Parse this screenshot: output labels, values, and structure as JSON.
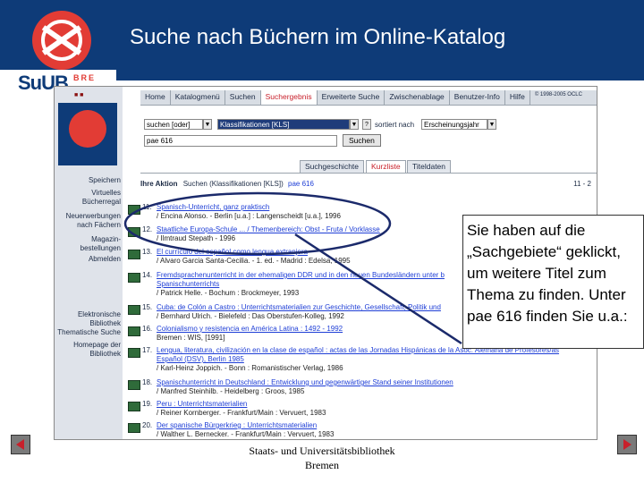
{
  "slide": {
    "title": "Suche nach Büchern im Online-Katalog",
    "logo": {
      "text": "SuUB",
      "sub": "BRE"
    },
    "footer_line1": "Staats- und Universitätsbibliothek",
    "footer_line2": "Bremen",
    "callout": "Sie haben auf die „Sachgebiete“ geklickt, um weitere Titel zum Thema zu finden. Unter pae 616  finden Sie u.a.:"
  },
  "opac": {
    "nav": {
      "home": "Home",
      "katalogmenue": "Katalogmenü",
      "suchen": "Suchen",
      "suchergebnis": "Suchergebnis",
      "erweiterte_suche": "Erweiterte Suche",
      "zwischenablage": "Zwischenablage",
      "benutzer_info": "Benutzer-Info",
      "hilfe": "Hilfe",
      "copyright": "© 1998-2005 OCLC"
    },
    "search": {
      "mode_value": "suchen [oder]",
      "field_value": "Klassifikationen [KLS]",
      "sort_label": "sortiert nach",
      "sort_value": "Erscheinungsjahr",
      "query_value": "pae 616",
      "submit_label": "Suchen"
    },
    "subtabs": {
      "suchgeschichte": "Suchgeschichte",
      "kurzliste": "Kurzliste",
      "titeldaten": "Titeldaten"
    },
    "action": {
      "label": "Ihre Aktion",
      "text": "Suchen (Klassifikationen [KLS])",
      "link": "pae 616",
      "page": "11 - 2"
    },
    "left_menu": {
      "speichern": "Speichern",
      "virtuelles_1": "Virtuelles",
      "virtuelles_2": "Bücherregal",
      "neuerwerb_1": "Neuerwerbungen",
      "neuerwerb_2": "nach Fächern",
      "magazin_1": "Magazin-",
      "magazin_2": "bestellungen",
      "abmelden": "Abmelden",
      "elek_1": "Elektronische",
      "elek_2": "Bibliothek",
      "themat": "Thematische Suche",
      "homepage_1": "Homepage der",
      "homepage_2": "Bibliothek"
    },
    "results": [
      {
        "num": "11.",
        "title": "Spanisch-Unterricht, ganz praktisch",
        "author": "/ Encina Alonso. - Berlin [u.a.] : Langenscheidt [u.a.], 1996"
      },
      {
        "num": "12.",
        "title": "Staatliche Europa-Schule ... / Themenbereich: Obst - Fruta / Vorklasse",
        "author": "/ Ilmtraud Stepath - 1996"
      },
      {
        "num": "13.",
        "title": "El currículo del español como lengua extranjera",
        "author": "/ Alvaro Garcia Santa-Cecilia. - 1. ed. - Madrid : Edelsa, 1995"
      },
      {
        "num": "14.",
        "title": "Fremdsprachenunterricht in der ehemaligen DDR und in den neuen Bundesländern unter b",
        "title2": "Spanischunterrichts",
        "author": "/ Patrick Helle. - Bochum : Brockmeyer, 1993"
      },
      {
        "num": "15.",
        "title": "Cuba: de Colón a Castro : Unterrichtsmaterialien zur Geschichte, Gesellschaft, Politik und",
        "author": "/ Bernhard Ulrich. - Bielefeld : Das Oberstufen-Kolleg, 1992"
      },
      {
        "num": "16.",
        "title": "Colonialismo y resistencia en América Latina : 1492 - 1992",
        "author": "Bremen : WIS, [1991]"
      },
      {
        "num": "17.",
        "title": "Lengua, literatura, civilización en la clase de español : actas de las Jornadas Hispánicas de la Asoc. Alemana de Profesores/as",
        "title2": "Español (DSV), Berlin 1985",
        "author": "/ Karl-Heinz Joppich. - Bonn : Romanistischer Verlag, 1986"
      },
      {
        "num": "18.",
        "title": "Spanischunterricht in Deutschland : Entwicklung und gegenwärtiger Stand seiner Institutionen",
        "author": "/ Manfred Steinhilb. - Heidelberg : Groos, 1985"
      },
      {
        "num": "19.",
        "title": "Peru : Unterrichtsmaterialien",
        "author": "/ Reiner Kornberger. - Frankfurt/Main : Vervuert, 1983"
      },
      {
        "num": "20.",
        "title": "Der spanische Bürgerkrieg : Unterrichtsmaterialien",
        "author": "/ Walther L. Bernecker. - Frankfurt/Main : Vervuert, 1983"
      }
    ]
  },
  "colors": {
    "brand_blue": "#0e3b78",
    "brand_red": "#e23c35",
    "link_blue": "#1e3ed6",
    "active_red": "#c8202b"
  }
}
